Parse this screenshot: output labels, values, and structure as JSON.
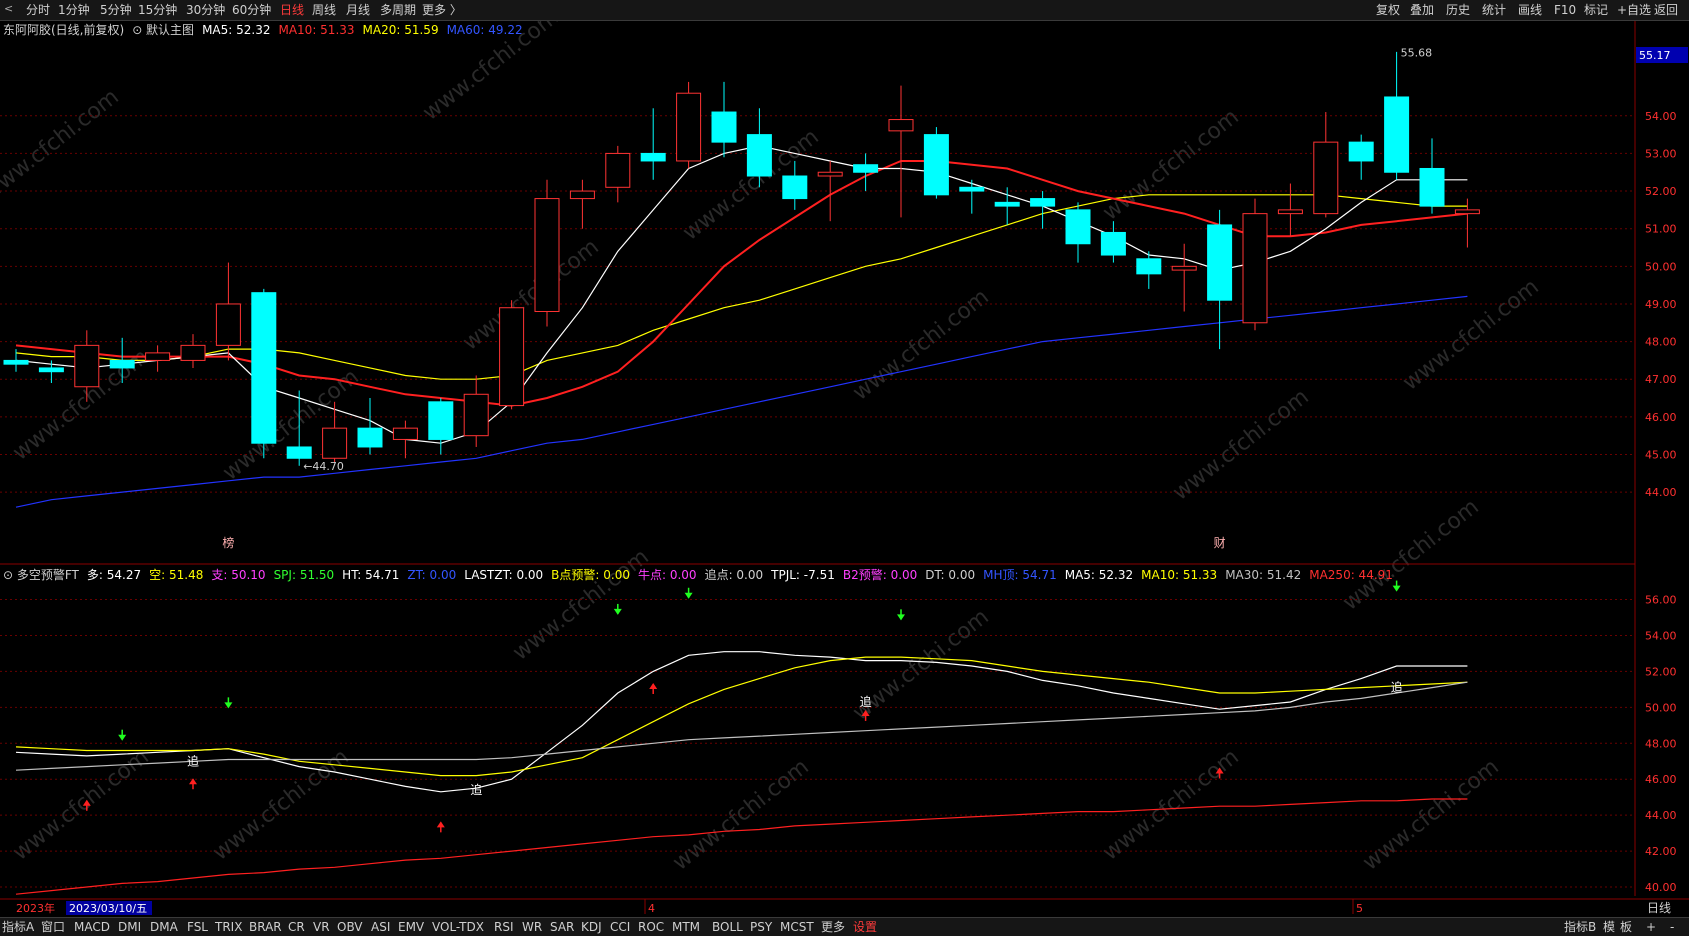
{
  "toolbar": {
    "back_arrow": "<",
    "periods": [
      "分时",
      "1分钟",
      "5分钟",
      "15分钟",
      "30分钟",
      "60分钟",
      "日线",
      "周线",
      "月线",
      "多周期",
      "更多 〉"
    ],
    "active_period": "日线",
    "right_buttons": [
      "复权",
      "叠加",
      "历史",
      "统计",
      "画线",
      "F10",
      "标记",
      "+自选",
      "返回"
    ]
  },
  "main_legend": [
    {
      "text": "东阿阿胶(日线,前复权)",
      "color": "#d0d0d0"
    },
    {
      "text": "⊙ 默认主图",
      "color": "#d0d0d0"
    },
    {
      "text": "MA5: 52.32",
      "color": "#ffffff"
    },
    {
      "text": "MA10: 51.33",
      "color": "#ff3030"
    },
    {
      "text": "MA20: 51.59",
      "color": "#ffff00"
    },
    {
      "text": "MA60: 49.22",
      "color": "#3355ff"
    }
  ],
  "sub_legend": [
    {
      "text": "⊙ 多空预警FT",
      "color": "#d0d0d0"
    },
    {
      "text": "多: 54.27",
      "color": "#ffffff"
    },
    {
      "text": "空: 51.48",
      "color": "#ffff00"
    },
    {
      "text": "支: 50.10",
      "color": "#ff40ff"
    },
    {
      "text": "SPJ: 51.50",
      "color": "#30ff30"
    },
    {
      "text": "HT: 54.71",
      "color": "#ffffff"
    },
    {
      "text": "ZT: 0.00",
      "color": "#3355ff"
    },
    {
      "text": "LASTZT: 0.00",
      "color": "#ffffff"
    },
    {
      "text": "B点预警: 0.00",
      "color": "#ffff00"
    },
    {
      "text": "牛点: 0.00",
      "color": "#ff40ff"
    },
    {
      "text": "追点: 0.00",
      "color": "#d0d0d0"
    },
    {
      "text": "TPJL: -7.51",
      "color": "#ffffff"
    },
    {
      "text": "B2预警: 0.00",
      "color": "#ff40ff"
    },
    {
      "text": "DT: 0.00",
      "color": "#d0d0d0"
    },
    {
      "text": "MH顶: 54.71",
      "color": "#3355ff"
    },
    {
      "text": "MA5: 52.32",
      "color": "#ffffff"
    },
    {
      "text": "MA10: 51.33",
      "color": "#ffff00"
    },
    {
      "text": "MA30: 51.42",
      "color": "#c0c0c0"
    },
    {
      "text": "MA250: 44.91",
      "color": "#ff3030"
    }
  ],
  "price_tag": "55.17",
  "date_label": "2023/03/10/五",
  "year_label": "2023年",
  "month_labels": [
    "4",
    "5"
  ],
  "right_period_label": "日线",
  "bottom_tabs": [
    "指标A",
    "窗口",
    "MACD",
    "DMI",
    "DMA",
    "FSL",
    "TRIX",
    "BRAR",
    "CR",
    "VR",
    "OBV",
    "ASI",
    "EMV",
    "VOL-TDX",
    "RSI",
    "WR",
    "SAR",
    "KDJ",
    "CCI",
    "ROC",
    "MTM",
    "BOLL",
    "PSY",
    "MCST",
    "更多",
    "设置"
  ],
  "bottom_right": [
    "指标B",
    "模",
    "板",
    "+",
    "-"
  ],
  "watermark": "www.cfchi.com",
  "colors": {
    "up": "#ff3333",
    "down": "#00ffff",
    "ma5": "#ffffff",
    "ma10": "#ff2020",
    "ma20": "#ffff00",
    "ma60": "#2233ff",
    "grid": "#6a0000",
    "axis": "#8a0000"
  },
  "chart_data": [
    {
      "type": "candlestick",
      "title": "东阿阿胶(日线,前复权)",
      "ylim": [
        43.1,
        56.2
      ],
      "yticks": [
        44.0,
        45.0,
        46.0,
        47.0,
        48.0,
        49.0,
        50.0,
        51.0,
        52.0,
        53.0,
        54.0
      ],
      "candles": [
        {
          "o": 47.5,
          "h": 47.8,
          "l": 47.2,
          "c": 47.4
        },
        {
          "o": 47.3,
          "h": 47.5,
          "l": 46.9,
          "c": 47.2
        },
        {
          "o": 46.8,
          "h": 48.3,
          "l": 46.4,
          "c": 47.9
        },
        {
          "o": 47.5,
          "h": 48.1,
          "l": 46.9,
          "c": 47.3
        },
        {
          "o": 47.5,
          "h": 47.9,
          "l": 47.2,
          "c": 47.7
        },
        {
          "o": 47.5,
          "h": 48.2,
          "l": 47.3,
          "c": 47.9
        },
        {
          "o": 47.9,
          "h": 50.1,
          "l": 47.5,
          "c": 49.0
        },
        {
          "o": 49.3,
          "h": 49.4,
          "l": 44.9,
          "c": 45.3
        },
        {
          "o": 45.2,
          "h": 46.7,
          "l": 44.7,
          "c": 44.9
        },
        {
          "o": 44.9,
          "h": 46.4,
          "l": 44.8,
          "c": 45.7
        },
        {
          "o": 45.7,
          "h": 46.5,
          "l": 45.0,
          "c": 45.2
        },
        {
          "o": 45.4,
          "h": 45.9,
          "l": 44.9,
          "c": 45.7
        },
        {
          "o": 46.4,
          "h": 46.5,
          "l": 45.0,
          "c": 45.4
        },
        {
          "o": 45.5,
          "h": 47.1,
          "l": 45.2,
          "c": 46.6
        },
        {
          "o": 46.3,
          "h": 49.1,
          "l": 46.2,
          "c": 48.9
        },
        {
          "o": 48.8,
          "h": 52.3,
          "l": 48.4,
          "c": 51.8
        },
        {
          "o": 51.8,
          "h": 52.3,
          "l": 51.0,
          "c": 52.0
        },
        {
          "o": 52.1,
          "h": 53.2,
          "l": 51.7,
          "c": 53.0
        },
        {
          "o": 53.0,
          "h": 54.2,
          "l": 52.3,
          "c": 52.8
        },
        {
          "o": 52.8,
          "h": 54.9,
          "l": 52.6,
          "c": 54.6
        },
        {
          "o": 54.1,
          "h": 54.9,
          "l": 52.9,
          "c": 53.3
        },
        {
          "o": 53.5,
          "h": 54.2,
          "l": 52.1,
          "c": 52.4
        },
        {
          "o": 52.4,
          "h": 52.8,
          "l": 51.5,
          "c": 51.8
        },
        {
          "o": 52.4,
          "h": 52.8,
          "l": 51.2,
          "c": 52.5
        },
        {
          "o": 52.7,
          "h": 53.0,
          "l": 52.0,
          "c": 52.5
        },
        {
          "o": 53.6,
          "h": 54.8,
          "l": 51.3,
          "c": 53.9
        },
        {
          "o": 53.5,
          "h": 53.7,
          "l": 51.8,
          "c": 51.9
        },
        {
          "o": 52.1,
          "h": 52.3,
          "l": 51.4,
          "c": 52.0
        },
        {
          "o": 51.7,
          "h": 52.1,
          "l": 51.1,
          "c": 51.6
        },
        {
          "o": 51.8,
          "h": 52.0,
          "l": 51.0,
          "c": 51.6
        },
        {
          "o": 51.5,
          "h": 51.7,
          "l": 50.1,
          "c": 50.6
        },
        {
          "o": 50.9,
          "h": 51.2,
          "l": 50.1,
          "c": 50.3
        },
        {
          "o": 50.2,
          "h": 50.4,
          "l": 49.4,
          "c": 49.8
        },
        {
          "o": 49.9,
          "h": 50.6,
          "l": 48.8,
          "c": 50.0
        },
        {
          "o": 51.1,
          "h": 51.5,
          "l": 47.8,
          "c": 49.1
        },
        {
          "o": 48.5,
          "h": 51.8,
          "l": 48.3,
          "c": 51.4
        },
        {
          "o": 51.4,
          "h": 52.2,
          "l": 50.8,
          "c": 51.5
        },
        {
          "o": 51.4,
          "h": 54.1,
          "l": 51.3,
          "c": 53.3
        },
        {
          "o": 53.3,
          "h": 53.5,
          "l": 52.3,
          "c": 52.8
        },
        {
          "o": 54.5,
          "h": 55.7,
          "l": 52.3,
          "c": 52.5
        },
        {
          "o": 52.6,
          "h": 53.4,
          "l": 51.4,
          "c": 51.6
        },
        {
          "o": 51.4,
          "h": 51.8,
          "l": 50.5,
          "c": 51.5
        }
      ],
      "ma5": [
        47.5,
        47.4,
        47.3,
        47.4,
        47.5,
        47.6,
        47.7,
        46.8,
        46.5,
        46.2,
        45.9,
        45.4,
        45.3,
        45.6,
        46.4,
        47.7,
        48.9,
        50.4,
        51.5,
        52.6,
        53.0,
        53.2,
        53.0,
        52.8,
        52.6,
        52.6,
        52.5,
        52.2,
        51.9,
        51.6,
        51.2,
        50.8,
        50.3,
        50.2,
        49.9,
        50.1,
        50.4,
        51.0,
        51.7,
        52.3,
        52.3,
        52.3
      ],
      "ma10": [
        47.9,
        47.8,
        47.7,
        47.6,
        47.6,
        47.6,
        47.6,
        47.4,
        47.1,
        47.0,
        46.8,
        46.6,
        46.5,
        46.4,
        46.3,
        46.5,
        46.8,
        47.2,
        48.0,
        49.0,
        50.0,
        50.7,
        51.3,
        51.9,
        52.4,
        52.8,
        52.8,
        52.7,
        52.6,
        52.3,
        52.0,
        51.8,
        51.6,
        51.4,
        51.1,
        50.8,
        50.8,
        50.9,
        51.1,
        51.2,
        51.3,
        51.4
      ],
      "ma20": [
        47.7,
        47.6,
        47.6,
        47.5,
        47.5,
        47.6,
        47.8,
        47.8,
        47.7,
        47.5,
        47.3,
        47.1,
        47.0,
        47.0,
        47.1,
        47.5,
        47.7,
        47.9,
        48.3,
        48.6,
        48.9,
        49.1,
        49.4,
        49.7,
        50.0,
        50.2,
        50.5,
        50.8,
        51.1,
        51.4,
        51.6,
        51.8,
        51.9,
        51.9,
        51.9,
        51.9,
        51.9,
        51.9,
        51.8,
        51.7,
        51.6,
        51.6
      ],
      "ma60": [
        43.6,
        43.8,
        43.9,
        44.0,
        44.1,
        44.2,
        44.3,
        44.4,
        44.4,
        44.5,
        44.6,
        44.7,
        44.8,
        44.9,
        45.1,
        45.3,
        45.4,
        45.6,
        45.8,
        46.0,
        46.2,
        46.4,
        46.6,
        46.8,
        47.0,
        47.2,
        47.4,
        47.6,
        47.8,
        48.0,
        48.1,
        48.2,
        48.3,
        48.4,
        48.5,
        48.6,
        48.7,
        48.8,
        48.9,
        49.0,
        49.1,
        49.2
      ],
      "annotations": [
        {
          "text": "←44.70",
          "index": 8,
          "price": 44.7
        },
        {
          "text": "55.68",
          "index": 39,
          "price": 55.68
        }
      ],
      "markers": [
        {
          "text": "榜",
          "index": 6
        },
        {
          "text": "财",
          "index": 34
        }
      ]
    },
    {
      "type": "line",
      "title": "多空预警FT",
      "ylim": [
        39.5,
        57.2
      ],
      "yticks": [
        40.0,
        42.0,
        44.0,
        46.0,
        48.0,
        50.0,
        52.0,
        54.0,
        56.0
      ],
      "series": [
        {
          "name": "多",
          "color": "#ffffff",
          "values": [
            47.5,
            47.4,
            47.3,
            47.4,
            47.5,
            47.6,
            47.7,
            47.2,
            46.7,
            46.4,
            46.0,
            45.6,
            45.3,
            45.5,
            46.0,
            47.5,
            49.0,
            50.8,
            52.0,
            52.9,
            53.1,
            53.1,
            52.9,
            52.8,
            52.6,
            52.6,
            52.5,
            52.3,
            52.0,
            51.5,
            51.2,
            50.8,
            50.5,
            50.2,
            49.9,
            50.1,
            50.3,
            51.0,
            51.6,
            52.3,
            52.3,
            52.3
          ]
        },
        {
          "name": "空",
          "color": "#ffff00",
          "values": [
            47.8,
            47.7,
            47.6,
            47.6,
            47.6,
            47.6,
            47.7,
            47.4,
            47.0,
            46.8,
            46.6,
            46.4,
            46.2,
            46.2,
            46.4,
            46.8,
            47.2,
            48.2,
            49.2,
            50.2,
            51.0,
            51.6,
            52.2,
            52.6,
            52.8,
            52.8,
            52.7,
            52.6,
            52.3,
            52.0,
            51.8,
            51.6,
            51.4,
            51.1,
            50.8,
            50.8,
            50.9,
            51.0,
            51.1,
            51.2,
            51.3,
            51.4
          ]
        },
        {
          "name": "支",
          "color": "#c0c0c0",
          "values": [
            46.5,
            46.6,
            46.7,
            46.8,
            46.9,
            47.0,
            47.1,
            47.1,
            47.1,
            47.1,
            47.1,
            47.1,
            47.1,
            47.1,
            47.2,
            47.4,
            47.6,
            47.8,
            48.0,
            48.2,
            48.3,
            48.4,
            48.5,
            48.6,
            48.7,
            48.8,
            48.9,
            49.0,
            49.1,
            49.2,
            49.3,
            49.4,
            49.5,
            49.6,
            49.7,
            49.8,
            50.0,
            50.3,
            50.5,
            50.8,
            51.1,
            51.4
          ]
        },
        {
          "name": "MA250",
          "color": "#ff2020",
          "values": [
            39.6,
            39.8,
            40.0,
            40.2,
            40.3,
            40.5,
            40.7,
            40.8,
            41.0,
            41.1,
            41.3,
            41.5,
            41.6,
            41.8,
            42.0,
            42.2,
            42.4,
            42.6,
            42.8,
            42.9,
            43.1,
            43.2,
            43.4,
            43.5,
            43.6,
            43.7,
            43.8,
            43.9,
            44.0,
            44.1,
            44.2,
            44.2,
            44.3,
            44.4,
            44.5,
            44.5,
            44.6,
            44.7,
            44.8,
            44.8,
            44.9,
            44.9
          ]
        }
      ],
      "up_arrows": [
        {
          "index": 2,
          "value": 44.8
        },
        {
          "index": 5,
          "value": 46.0
        },
        {
          "index": 12,
          "value": 43.6
        },
        {
          "index": 18,
          "value": 51.3
        },
        {
          "index": 24,
          "value": 49.8
        },
        {
          "index": 34,
          "value": 46.6
        }
      ],
      "down_arrows": [
        {
          "index": 3,
          "value": 48.2
        },
        {
          "index": 6,
          "value": 50.0
        },
        {
          "index": 17,
          "value": 55.2
        },
        {
          "index": 19,
          "value": 56.1
        },
        {
          "index": 25,
          "value": 54.9
        },
        {
          "index": 39,
          "value": 56.5
        }
      ],
      "chase_labels": [
        {
          "text": "追",
          "index": 5,
          "value": 47.0
        },
        {
          "text": "追",
          "index": 13,
          "value": 45.4
        },
        {
          "text": "追",
          "index": 24,
          "value": 50.3
        },
        {
          "text": "追",
          "index": 39,
          "value": 51.1
        }
      ]
    }
  ]
}
